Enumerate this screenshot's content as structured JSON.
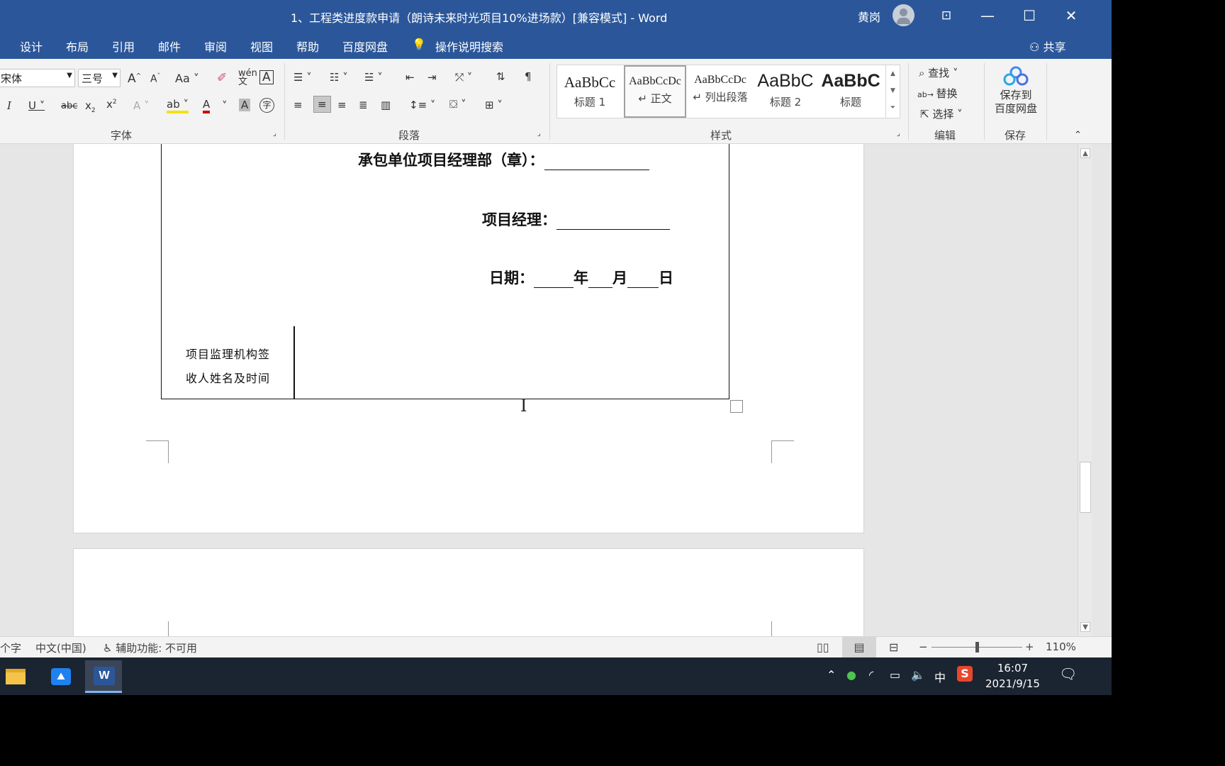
{
  "window": {
    "title": "1、工程类进度款申请（朗诗未来时光项目10%进场款）[兼容模式] - Word",
    "user": "黄岗"
  },
  "menu": {
    "tabs": [
      "设计",
      "布局",
      "引用",
      "邮件",
      "审阅",
      "视图",
      "帮助",
      "百度网盘"
    ],
    "tell_me": "操作说明搜索",
    "share": "共享"
  },
  "ribbon": {
    "font": {
      "name": "宋体",
      "size": "三号",
      "group_label": "字体"
    },
    "paragraph": {
      "group_label": "段落"
    },
    "styles": {
      "group_label": "样式",
      "items": [
        {
          "sample": "AaBbCc",
          "name": "标题 1"
        },
        {
          "sample": "AaBbCcDc",
          "name": "↵ 正文"
        },
        {
          "sample": "AaBbCcDc",
          "name": "↵ 列出段落"
        },
        {
          "sample": "AaBbC",
          "name": "标题 2"
        },
        {
          "sample": "AaBbC",
          "name": "标题"
        }
      ]
    },
    "editing": {
      "group_label": "编辑",
      "find": "查找",
      "replace": "替换",
      "select": "选择"
    },
    "save": {
      "group_label": "保存",
      "label_line1": "保存到",
      "label_line2": "百度网盘"
    }
  },
  "document": {
    "contractor_label": "承包单位项目经理部（章）：",
    "manager_label": "项目经理：",
    "date_label": "日期：",
    "date_year": "年",
    "date_month": "月",
    "date_day": "日",
    "supervisor_line1": "项目监理机构签",
    "supervisor_line2": "收人姓名及时间"
  },
  "status": {
    "word_count": "个字",
    "language": "中文(中国)",
    "accessibility": "辅助功能: 不可用",
    "zoom": "110%"
  },
  "taskbar": {
    "ime": "中",
    "time": "16:07",
    "date": "2021/9/15"
  }
}
